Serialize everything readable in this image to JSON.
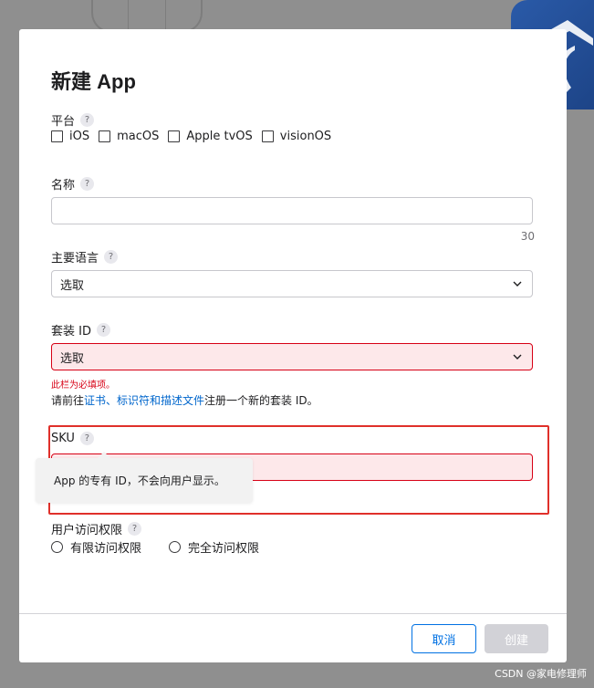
{
  "modal": {
    "title": "新建 App",
    "platform": {
      "label": "平台",
      "options": [
        "iOS",
        "macOS",
        "Apple tvOS",
        "visionOS"
      ]
    },
    "name": {
      "label": "名称",
      "value": "",
      "counter": "30"
    },
    "primary_language": {
      "label": "主要语言",
      "value": "选取"
    },
    "bundle_id": {
      "label": "套装 ID",
      "value": "选取",
      "error": "此栏为必填项。",
      "hint_prefix": "请前往",
      "hint_link": "证书、标识符和描述文件",
      "hint_suffix": "注册一个新的套装 ID。"
    },
    "sku": {
      "label": "SKU",
      "value": "",
      "tooltip": "App 的专有 ID，不会向用户显示。"
    },
    "user_access": {
      "label": "用户访问权限",
      "options": [
        "有限访问权限",
        "完全访问权限"
      ]
    },
    "buttons": {
      "cancel": "取消",
      "create": "创建"
    },
    "help_glyph": "?"
  },
  "colors": {
    "accent": "#0071e3",
    "error": "#d70015",
    "annotation": "#e0302a",
    "overlay": "#8f8f8f"
  },
  "watermark": "CSDN @家电修理师"
}
